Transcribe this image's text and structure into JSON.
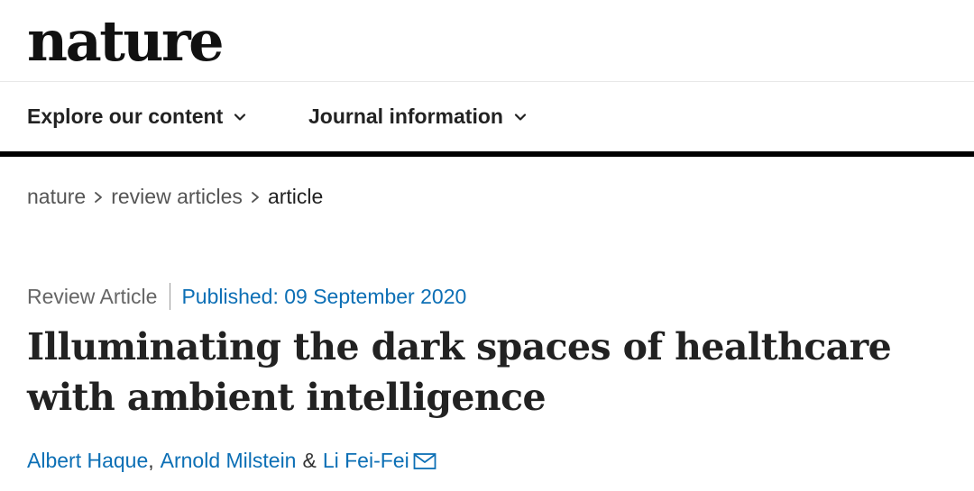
{
  "site": {
    "logo": "nature"
  },
  "nav": {
    "items": [
      {
        "label": "Explore our content",
        "icon": "chevron-down-icon"
      },
      {
        "label": "Journal information",
        "icon": "chevron-down-icon"
      }
    ]
  },
  "breadcrumb": {
    "items": [
      {
        "label": "nature"
      },
      {
        "label": "review articles"
      },
      {
        "label": "article"
      }
    ],
    "separator_icon": "chevron-right-icon"
  },
  "article": {
    "type": "Review Article",
    "published": "Published: 09 September 2020",
    "title": "Illuminating the dark spaces of healthcare with ambient intelligence",
    "authors": [
      {
        "name": "Albert Haque"
      },
      {
        "name": "Arnold Milstein"
      },
      {
        "name": "Li Fei-Fei"
      }
    ],
    "author_separator": ",",
    "author_conjunction": "&",
    "corresponding_icon": "envelope-icon"
  },
  "colors": {
    "link": "#0c6fb5",
    "rule": "#000000",
    "text": "#222222"
  }
}
